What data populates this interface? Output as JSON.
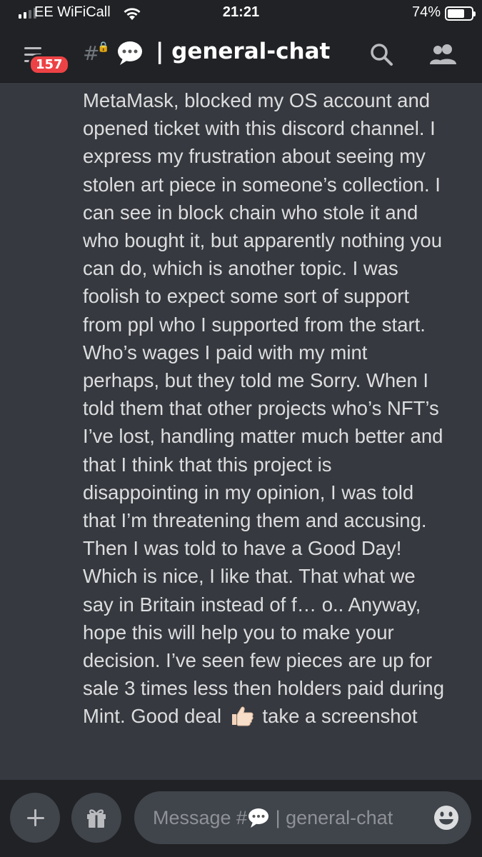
{
  "status_bar": {
    "carrier": "EE WiFiCall",
    "time": "21:21",
    "battery_percent": "74%",
    "battery_level": 0.74,
    "signal_bars_filled": 2,
    "signal_bars_total": 4
  },
  "header": {
    "unread_badge": "157",
    "channel_separator": "|",
    "channel_name": "general-chat",
    "icons": [
      "menu-icon",
      "hash-lock-icon",
      "speech-balloon-icon",
      "search-icon",
      "members-icon"
    ]
  },
  "message": {
    "lines": [
      "MetaMask, blocked my OS account and",
      "opened ticket with this discord channel. I",
      "express my frustration about seeing my",
      "stolen art piece in someone’s collection. I",
      "can see in block chain who stole it and",
      "who bought it, but apparently nothing you",
      "can do, which is another topic. I was",
      "foolish to expect some sort of support",
      "from ppl who I supported from the start.",
      "Who’s wages I paid with my mint",
      "perhaps, but they told me Sorry. When I",
      "told them that other projects who’s NFT’s",
      "I’ve lost, handling matter much better and",
      "that I think that this project is",
      "disappointing in my opinion, I was told",
      "that I’m threatening them and accusing.",
      "Then I was told to have a Good Day!",
      "Which is nice, I like that. That what we",
      "say in Britain instead of f… o..   Anyway,",
      "hope this will help you to make your",
      "decision. I’ve seen few pieces are up for",
      "sale 3 times less then holders paid during"
    ],
    "last_line_before": "Mint. Good deal",
    "last_line_after": "take a screenshot"
  },
  "composer": {
    "placeholder_prefix": "Message #",
    "placeholder_suffix": "| general-chat",
    "icons": [
      "plus-icon",
      "gift-icon",
      "emoji-icon"
    ]
  },
  "colors": {
    "background": "#36393f",
    "header_bg": "#202225",
    "text": "#dcddde",
    "badge": "#ed4245",
    "input_bg": "#40444b"
  }
}
